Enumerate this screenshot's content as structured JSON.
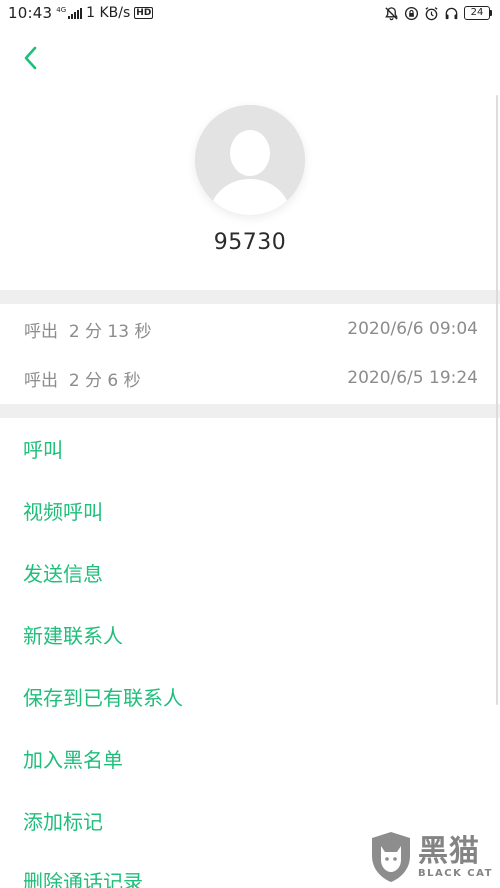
{
  "status_bar": {
    "time": "10:43",
    "network_type": "4G",
    "speed": "1 KB/s",
    "hd_badge": "HD",
    "battery": "24"
  },
  "contact": {
    "number": "95730"
  },
  "call_log": [
    {
      "type": "呼出",
      "duration": "2 分 13 秒",
      "datetime": "2020/6/6 09:04"
    },
    {
      "type": "呼出",
      "duration": "2 分 6 秒",
      "datetime": "2020/6/5 19:24"
    }
  ],
  "actions": [
    "呼叫",
    "视频呼叫",
    "发送信息",
    "新建联系人",
    "保存到已有联系人",
    "加入黑名单",
    "添加标记",
    "删除通话记录"
  ],
  "watermark": {
    "cn": "黑猫",
    "en": "BLACK CAT"
  },
  "colors": {
    "accent": "#1fbe7a",
    "muted_text": "#8c8c8c",
    "divider": "#efefef"
  }
}
